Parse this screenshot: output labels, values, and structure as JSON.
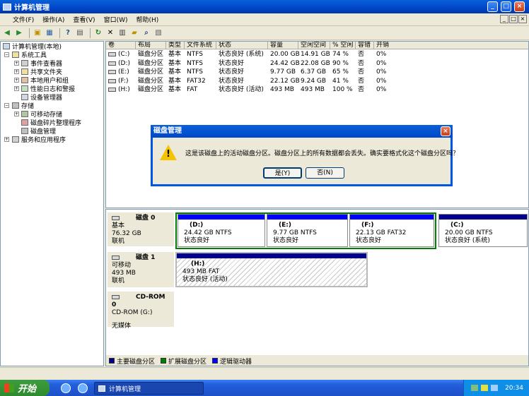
{
  "window": {
    "title": "计算机管理",
    "min": "_",
    "max": "□",
    "close": "×"
  },
  "menu": [
    "文件(F)",
    "操作(A)",
    "查看(V)",
    "窗口(W)",
    "帮助(H)"
  ],
  "tree": {
    "root": "计算机管理(本地)",
    "system_tools": "系统工具",
    "event_viewer": "事件查看器",
    "shared_folders": "共享文件夹",
    "local_users": "本地用户和组",
    "perf_logs": "性能日志和警报",
    "device_manager": "设备管理器",
    "storage": "存储",
    "removable_storage": "可移动存储",
    "defrag": "磁盘碎片整理程序",
    "disk_mgmt": "磁盘管理",
    "services": "服务和应用程序"
  },
  "volumes": {
    "headers": [
      "卷",
      "布局",
      "类型",
      "文件系统",
      "状态",
      "容量",
      "空闲空间",
      "% 空闲",
      "容错",
      "开销"
    ],
    "rows": [
      [
        "(C:)",
        "磁盘分区",
        "基本",
        "NTFS",
        "状态良好 (系统)",
        "20.00 GB",
        "14.91 GB",
        "74 %",
        "否",
        "0%"
      ],
      [
        "(D:)",
        "磁盘分区",
        "基本",
        "NTFS",
        "状态良好",
        "24.42 GB",
        "22.08 GB",
        "90 %",
        "否",
        "0%"
      ],
      [
        "(E:)",
        "磁盘分区",
        "基本",
        "NTFS",
        "状态良好",
        "9.77 GB",
        "6.37 GB",
        "65 %",
        "否",
        "0%"
      ],
      [
        "(F:)",
        "磁盘分区",
        "基本",
        "FAT32",
        "状态良好",
        "22.12 GB",
        "9.24 GB",
        "41 %",
        "否",
        "0%"
      ],
      [
        "(H:)",
        "磁盘分区",
        "基本",
        "FAT",
        "状态良好 (活动)",
        "493 MB",
        "493 MB",
        "100 %",
        "否",
        "0%"
      ]
    ]
  },
  "disks": {
    "disk0": {
      "name": "磁盘 0",
      "type": "基本",
      "size": "76.32 GB",
      "status": "联机",
      "parts": [
        {
          "label": "(D:)",
          "info": "24.42 GB NTFS",
          "status": "状态良好"
        },
        {
          "label": "(E:)",
          "info": "9.77 GB NTFS",
          "status": "状态良好"
        },
        {
          "label": "(F:)",
          "info": "22.13 GB FAT32",
          "status": "状态良好"
        },
        {
          "label": "(C:)",
          "info": "20.00 GB NTFS",
          "status": "状态良好 (系统)"
        }
      ]
    },
    "disk1": {
      "name": "磁盘 1",
      "type": "可移动",
      "size": "493 MB",
      "status": "联机",
      "part": {
        "label": "(H:)",
        "info": "493 MB FAT",
        "status": "状态良好 (活动)"
      }
    },
    "cdrom": {
      "name": "CD-ROM 0",
      "type": "CD-ROM (G:)",
      "status": "无媒体"
    }
  },
  "legend": [
    "主要磁盘分区",
    "扩展磁盘分区",
    "逻辑驱动器"
  ],
  "colors": {
    "primary": "#00008b",
    "extended": "#008000",
    "logical": "#0000ff"
  },
  "dialog": {
    "title": "磁盘管理",
    "message": "这是该磁盘上的活动磁盘分区。磁盘分区上的所有数据都会丢失。确实要格式化这个磁盘分区吗？",
    "yes": "是(Y)",
    "no": "否(N)",
    "close": "×"
  },
  "taskbar": {
    "start": "开始",
    "task": "计算机管理",
    "clock": "20:34"
  }
}
